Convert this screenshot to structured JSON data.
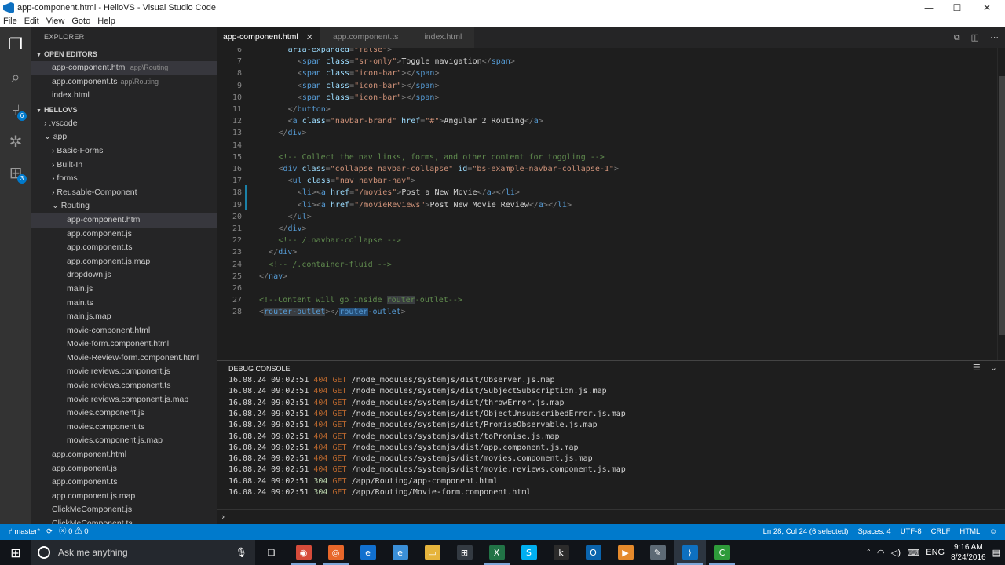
{
  "window": {
    "title": "app-component.html - HelloVS - Visual Studio Code",
    "controls": {
      "minimize": "—",
      "maximize": "☐",
      "close": "✕"
    }
  },
  "menu": [
    "File",
    "Edit",
    "View",
    "Goto",
    "Help"
  ],
  "activity_bar": {
    "items": [
      {
        "name": "explorer-icon",
        "glyph": "❐",
        "badge": ""
      },
      {
        "name": "search-icon",
        "glyph": "⌕",
        "badge": ""
      },
      {
        "name": "git-icon",
        "glyph": "⑂",
        "badge": "6"
      },
      {
        "name": "debug-icon",
        "glyph": "✲",
        "badge": ""
      },
      {
        "name": "extensions-icon",
        "glyph": "⊞",
        "badge": "3"
      }
    ]
  },
  "explorer": {
    "title": "EXPLORER",
    "open_editors_label": "OPEN EDITORS",
    "open_editors": [
      {
        "name": "app-component.html",
        "hint": "app\\Routing"
      },
      {
        "name": "app.component.ts",
        "hint": "app\\Routing"
      },
      {
        "name": "index.html",
        "hint": ""
      }
    ],
    "project_label": "HELLOVS",
    "tree": [
      {
        "label": "› .vscode",
        "depth": 1
      },
      {
        "label": "⌄ app",
        "depth": 1
      },
      {
        "label": "› Basic-Forms",
        "depth": 2
      },
      {
        "label": "› Built-In",
        "depth": 2
      },
      {
        "label": "› forms",
        "depth": 2
      },
      {
        "label": "› Reusable-Component",
        "depth": 2
      },
      {
        "label": "⌄ Routing",
        "depth": 2
      },
      {
        "label": "app-component.html",
        "depth": 3
      },
      {
        "label": "app.component.js",
        "depth": 3
      },
      {
        "label": "app.component.ts",
        "depth": 3
      },
      {
        "label": "app.component.js.map",
        "depth": 3
      },
      {
        "label": "dropdown.js",
        "depth": 3
      },
      {
        "label": "main.js",
        "depth": 3
      },
      {
        "label": "main.ts",
        "depth": 3
      },
      {
        "label": "main.js.map",
        "depth": 3
      },
      {
        "label": "movie-component.html",
        "depth": 3
      },
      {
        "label": "Movie-form.component.html",
        "depth": 3
      },
      {
        "label": "Movie-Review-form.component.html",
        "depth": 3
      },
      {
        "label": "movie.reviews.component.js",
        "depth": 3
      },
      {
        "label": "movie.reviews.component.ts",
        "depth": 3
      },
      {
        "label": "movie.reviews.component.js.map",
        "depth": 3
      },
      {
        "label": "movies.component.js",
        "depth": 3
      },
      {
        "label": "movies.component.ts",
        "depth": 3
      },
      {
        "label": "movies.component.js.map",
        "depth": 3
      },
      {
        "label": "app.component.html",
        "depth": 2
      },
      {
        "label": "app.component.js",
        "depth": 2
      },
      {
        "label": "app.component.ts",
        "depth": 2
      },
      {
        "label": "app.component.js.map",
        "depth": 2
      },
      {
        "label": "ClickMeComponent.js",
        "depth": 2
      },
      {
        "label": "ClickMeComponent.ts",
        "depth": 2
      }
    ]
  },
  "tabs": [
    {
      "label": "app-component.html",
      "active": true,
      "close": "✕"
    },
    {
      "label": "app.component.ts",
      "active": false,
      "close": ""
    },
    {
      "label": "index.html",
      "active": false,
      "close": ""
    }
  ],
  "tab_actions": [
    "⧉",
    "◫",
    "⋯"
  ],
  "code_lines": [
    {
      "n": "6",
      "indent": 6,
      "seg": [
        [
          "t-attr",
          "aria-expanded"
        ],
        [
          "t-punct",
          "="
        ],
        [
          "t-str",
          "\"false\""
        ],
        [
          "t-punct",
          ">"
        ]
      ]
    },
    {
      "n": "7",
      "indent": 8,
      "seg": [
        [
          "t-punct",
          "<"
        ],
        [
          "t-tag",
          "span"
        ],
        [
          "t-txt",
          " "
        ],
        [
          "t-attr",
          "class"
        ],
        [
          "t-punct",
          "="
        ],
        [
          "t-str",
          "\"sr-only\""
        ],
        [
          "t-punct",
          ">"
        ],
        [
          "t-txt",
          "Toggle navigation"
        ],
        [
          "t-punct",
          "</"
        ],
        [
          "t-tag",
          "span"
        ],
        [
          "t-punct",
          ">"
        ]
      ]
    },
    {
      "n": "8",
      "indent": 8,
      "seg": [
        [
          "t-punct",
          "<"
        ],
        [
          "t-tag",
          "span"
        ],
        [
          "t-txt",
          " "
        ],
        [
          "t-attr",
          "class"
        ],
        [
          "t-punct",
          "="
        ],
        [
          "t-str",
          "\"icon-bar\""
        ],
        [
          "t-punct",
          "></"
        ],
        [
          "t-tag",
          "span"
        ],
        [
          "t-punct",
          ">"
        ]
      ]
    },
    {
      "n": "9",
      "indent": 8,
      "seg": [
        [
          "t-punct",
          "<"
        ],
        [
          "t-tag",
          "span"
        ],
        [
          "t-txt",
          " "
        ],
        [
          "t-attr",
          "class"
        ],
        [
          "t-punct",
          "="
        ],
        [
          "t-str",
          "\"icon-bar\""
        ],
        [
          "t-punct",
          "></"
        ],
        [
          "t-tag",
          "span"
        ],
        [
          "t-punct",
          ">"
        ]
      ]
    },
    {
      "n": "10",
      "indent": 8,
      "seg": [
        [
          "t-punct",
          "<"
        ],
        [
          "t-tag",
          "span"
        ],
        [
          "t-txt",
          " "
        ],
        [
          "t-attr",
          "class"
        ],
        [
          "t-punct",
          "="
        ],
        [
          "t-str",
          "\"icon-bar\""
        ],
        [
          "t-punct",
          "></"
        ],
        [
          "t-tag",
          "span"
        ],
        [
          "t-punct",
          ">"
        ]
      ]
    },
    {
      "n": "11",
      "indent": 6,
      "seg": [
        [
          "t-punct",
          "</"
        ],
        [
          "t-tag",
          "button"
        ],
        [
          "t-punct",
          ">"
        ]
      ]
    },
    {
      "n": "12",
      "indent": 6,
      "seg": [
        [
          "t-punct",
          "<"
        ],
        [
          "t-tag",
          "a"
        ],
        [
          "t-txt",
          " "
        ],
        [
          "t-attr",
          "class"
        ],
        [
          "t-punct",
          "="
        ],
        [
          "t-str",
          "\"navbar-brand\""
        ],
        [
          "t-txt",
          " "
        ],
        [
          "t-attr",
          "href"
        ],
        [
          "t-punct",
          "="
        ],
        [
          "t-str",
          "\"#\""
        ],
        [
          "t-punct",
          ">"
        ],
        [
          "t-txt",
          "Angular 2 Routing"
        ],
        [
          "t-punct",
          "</"
        ],
        [
          "t-tag",
          "a"
        ],
        [
          "t-punct",
          ">"
        ]
      ]
    },
    {
      "n": "13",
      "indent": 4,
      "seg": [
        [
          "t-punct",
          "</"
        ],
        [
          "t-tag",
          "div"
        ],
        [
          "t-punct",
          ">"
        ]
      ]
    },
    {
      "n": "14",
      "indent": 0,
      "seg": []
    },
    {
      "n": "15",
      "indent": 4,
      "seg": [
        [
          "t-cmt",
          "<!-- Collect the nav links, forms, and other content for toggling -->"
        ]
      ]
    },
    {
      "n": "16",
      "indent": 4,
      "seg": [
        [
          "t-punct",
          "<"
        ],
        [
          "t-tag",
          "div"
        ],
        [
          "t-txt",
          " "
        ],
        [
          "t-attr",
          "class"
        ],
        [
          "t-punct",
          "="
        ],
        [
          "t-str",
          "\"collapse navbar-collapse\""
        ],
        [
          "t-txt",
          " "
        ],
        [
          "t-attr",
          "id"
        ],
        [
          "t-punct",
          "="
        ],
        [
          "t-str",
          "\"bs-example-navbar-collapse-1\""
        ],
        [
          "t-punct",
          ">"
        ]
      ]
    },
    {
      "n": "17",
      "indent": 6,
      "seg": [
        [
          "t-punct",
          "<"
        ],
        [
          "t-tag",
          "ul"
        ],
        [
          "t-txt",
          " "
        ],
        [
          "t-attr",
          "class"
        ],
        [
          "t-punct",
          "="
        ],
        [
          "t-str",
          "\"nav navbar-nav\""
        ],
        [
          "t-punct",
          ">"
        ]
      ]
    },
    {
      "n": "18",
      "indent": 8,
      "seg": [
        [
          "t-punct",
          "<"
        ],
        [
          "t-tag",
          "li"
        ],
        [
          "t-punct",
          "><"
        ],
        [
          "t-tag",
          "a"
        ],
        [
          "t-txt",
          " "
        ],
        [
          "t-attr",
          "href"
        ],
        [
          "t-punct",
          "="
        ],
        [
          "t-str",
          "\"/movies\""
        ],
        [
          "t-punct",
          ">"
        ],
        [
          "t-txt",
          "Post a New Movie"
        ],
        [
          "t-punct",
          "</"
        ],
        [
          "t-tag",
          "a"
        ],
        [
          "t-punct",
          "></"
        ],
        [
          "t-tag",
          "li"
        ],
        [
          "t-punct",
          ">"
        ]
      ]
    },
    {
      "n": "19",
      "indent": 8,
      "seg": [
        [
          "t-punct",
          "<"
        ],
        [
          "t-tag",
          "li"
        ],
        [
          "t-punct",
          "><"
        ],
        [
          "t-tag",
          "a"
        ],
        [
          "t-txt",
          " "
        ],
        [
          "t-attr",
          "href"
        ],
        [
          "t-punct",
          "="
        ],
        [
          "t-str",
          "\"/movieReviews\""
        ],
        [
          "t-punct",
          ">"
        ],
        [
          "t-txt",
          "Post New Movie Review"
        ],
        [
          "t-punct",
          "</"
        ],
        [
          "t-tag",
          "a"
        ],
        [
          "t-punct",
          "></"
        ],
        [
          "t-tag",
          "li"
        ],
        [
          "t-punct",
          ">"
        ]
      ]
    },
    {
      "n": "20",
      "indent": 6,
      "seg": [
        [
          "t-punct",
          "</"
        ],
        [
          "t-tag",
          "ul"
        ],
        [
          "t-punct",
          ">"
        ]
      ]
    },
    {
      "n": "21",
      "indent": 4,
      "seg": [
        [
          "t-punct",
          "</"
        ],
        [
          "t-tag",
          "div"
        ],
        [
          "t-punct",
          ">"
        ]
      ]
    },
    {
      "n": "22",
      "indent": 4,
      "seg": [
        [
          "t-cmt",
          "<!-- /.navbar-collapse -->"
        ]
      ]
    },
    {
      "n": "23",
      "indent": 2,
      "seg": [
        [
          "t-punct",
          "</"
        ],
        [
          "t-tag",
          "div"
        ],
        [
          "t-punct",
          ">"
        ]
      ]
    },
    {
      "n": "24",
      "indent": 2,
      "seg": [
        [
          "t-cmt",
          "<!-- /.container-fluid -->"
        ]
      ]
    },
    {
      "n": "25",
      "indent": 0,
      "seg": [
        [
          "t-punct",
          "</"
        ],
        [
          "t-tag",
          "nav"
        ],
        [
          "t-punct",
          ">"
        ]
      ]
    },
    {
      "n": "26",
      "indent": 0,
      "seg": []
    },
    {
      "n": "27",
      "indent": 0,
      "seg": [
        [
          "t-cmt",
          "<!--Content will go inside "
        ],
        [
          "t-cmt t-hl2",
          "router"
        ],
        [
          "t-cmt",
          "-outlet-->"
        ]
      ]
    },
    {
      "n": "28",
      "indent": 0,
      "seg": [
        [
          "t-punct",
          "<"
        ],
        [
          "t-tag t-hl2",
          "router-outlet"
        ],
        [
          "t-punct",
          "></"
        ],
        [
          "t-tag t-hl",
          "router"
        ],
        [
          "t-tag",
          "-outlet"
        ],
        [
          "t-punct",
          ">"
        ]
      ]
    }
  ],
  "debug_console": {
    "title": "DEBUG CONSOLE",
    "actions": [
      "☰",
      "⌄"
    ],
    "prompt": "›",
    "logs": [
      {
        "ts": "16.08.24 09:02:51",
        "status": "404",
        "method": "GET",
        "path": "/node_modules/systemjs/dist/Observer.js.map"
      },
      {
        "ts": "16.08.24 09:02:51",
        "status": "404",
        "method": "GET",
        "path": "/node_modules/systemjs/dist/SubjectSubscription.js.map"
      },
      {
        "ts": "16.08.24 09:02:51",
        "status": "404",
        "method": "GET",
        "path": "/node_modules/systemjs/dist/throwError.js.map"
      },
      {
        "ts": "16.08.24 09:02:51",
        "status": "404",
        "method": "GET",
        "path": "/node_modules/systemjs/dist/ObjectUnsubscribedError.js.map"
      },
      {
        "ts": "16.08.24 09:02:51",
        "status": "404",
        "method": "GET",
        "path": "/node_modules/systemjs/dist/PromiseObservable.js.map"
      },
      {
        "ts": "16.08.24 09:02:51",
        "status": "404",
        "method": "GET",
        "path": "/node_modules/systemjs/dist/toPromise.js.map"
      },
      {
        "ts": "16.08.24 09:02:51",
        "status": "404",
        "method": "GET",
        "path": "/node_modules/systemjs/dist/app.component.js.map"
      },
      {
        "ts": "16.08.24 09:02:51",
        "status": "404",
        "method": "GET",
        "path": "/node_modules/systemjs/dist/movies.component.js.map"
      },
      {
        "ts": "16.08.24 09:02:51",
        "status": "404",
        "method": "GET",
        "path": "/node_modules/systemjs/dist/movie.reviews.component.js.map"
      },
      {
        "ts": "16.08.24 09:02:51",
        "status": "304",
        "method": "GET",
        "path": "/app/Routing/app-component.html"
      },
      {
        "ts": "16.08.24 09:02:51",
        "status": "304",
        "method": "GET",
        "path": "/app/Routing/Movie-form.component.html"
      }
    ]
  },
  "status_bar": {
    "branch": "master*",
    "sync_icon": "⟳",
    "errors": "ⓧ 0 ⚠ 0",
    "position": "Ln 28, Col 24 (6 selected)",
    "spaces": "Spaces: 4",
    "encoding": "UTF-8",
    "eol": "CRLF",
    "language": "HTML",
    "smiley": "☺"
  },
  "taskbar": {
    "start_glyph": "⊞",
    "search_placeholder": "Ask me anything",
    "mic": "🎙",
    "apps": [
      {
        "name": "task-view-icon",
        "glyph": "❏",
        "color": "#111419",
        "open": false
      },
      {
        "name": "chrome-icon",
        "glyph": "◉",
        "color": "#d64b3a",
        "open": true
      },
      {
        "name": "firefox-icon",
        "glyph": "◎",
        "color": "#e8672a",
        "open": true
      },
      {
        "name": "edge-icon",
        "glyph": "e",
        "color": "#1170cf",
        "open": false
      },
      {
        "name": "ie-icon",
        "glyph": "e",
        "color": "#3a8fd8",
        "open": false
      },
      {
        "name": "file-explorer-icon",
        "glyph": "▭",
        "color": "#e6b43c",
        "open": false
      },
      {
        "name": "store-icon",
        "glyph": "⊞",
        "color": "#333a42",
        "open": false
      },
      {
        "name": "excel-icon",
        "glyph": "X",
        "color": "#217346",
        "open": true
      },
      {
        "name": "skype-icon",
        "glyph": "S",
        "color": "#00aff0",
        "open": false
      },
      {
        "name": "kindle-icon",
        "glyph": "k",
        "color": "#2b2b2b",
        "open": false
      },
      {
        "name": "outlook-icon",
        "glyph": "O",
        "color": "#0a64ad",
        "open": false
      },
      {
        "name": "media-player-icon",
        "glyph": "▶",
        "color": "#e58a2c",
        "open": false
      },
      {
        "name": "settings-tool-icon",
        "glyph": "✎",
        "color": "#5d6a75",
        "open": false
      },
      {
        "name": "vscode-icon",
        "glyph": "⟩",
        "color": "#0e70c0",
        "open": true,
        "active": true
      },
      {
        "name": "camtasia-icon",
        "glyph": "C",
        "color": "#2e9b3a",
        "open": true
      }
    ],
    "tray": {
      "chevron": "˄",
      "network": "◠",
      "volume": "◁)",
      "keyboard": "⌨",
      "language": "ENG",
      "time": "9:16 AM",
      "date": "8/24/2016",
      "notifications": "▤"
    }
  }
}
